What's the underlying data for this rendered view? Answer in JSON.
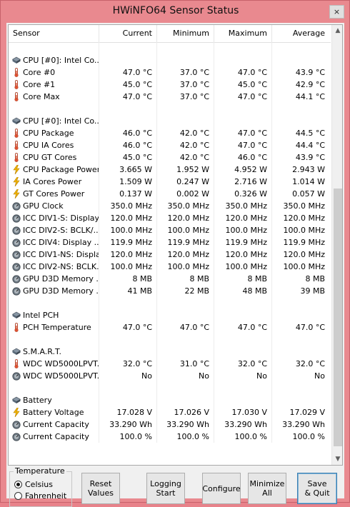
{
  "window": {
    "title": "HWiNFO64 Sensor Status",
    "close_glyph": "×"
  },
  "columns": [
    "Sensor",
    "Current",
    "Minimum",
    "Maximum",
    "Average"
  ],
  "rows": [
    {
      "kind": "blank"
    },
    {
      "kind": "group",
      "icon": "chip",
      "name": "CPU [#0]: Intel Co..."
    },
    {
      "kind": "data",
      "icon": "thermo",
      "name": "Core #0",
      "cur": "47.0 °C",
      "min": "37.0 °C",
      "max": "47.0 °C",
      "avg": "43.9 °C"
    },
    {
      "kind": "data",
      "icon": "thermo",
      "name": "Core #1",
      "cur": "45.0 °C",
      "min": "37.0 °C",
      "max": "45.0 °C",
      "avg": "42.9 °C"
    },
    {
      "kind": "data",
      "icon": "thermo",
      "name": "Core Max",
      "cur": "47.0 °C",
      "min": "37.0 °C",
      "max": "47.0 °C",
      "avg": "44.1 °C"
    },
    {
      "kind": "blank"
    },
    {
      "kind": "group",
      "icon": "chip",
      "name": "CPU [#0]: Intel Co..."
    },
    {
      "kind": "data",
      "icon": "thermo",
      "name": "CPU Package",
      "cur": "46.0 °C",
      "min": "42.0 °C",
      "max": "47.0 °C",
      "avg": "44.5 °C"
    },
    {
      "kind": "data",
      "icon": "thermo",
      "name": "CPU IA Cores",
      "cur": "46.0 °C",
      "min": "42.0 °C",
      "max": "47.0 °C",
      "avg": "44.4 °C"
    },
    {
      "kind": "data",
      "icon": "thermo",
      "name": "CPU GT Cores",
      "cur": "45.0 °C",
      "min": "42.0 °C",
      "max": "46.0 °C",
      "avg": "43.9 °C"
    },
    {
      "kind": "data",
      "icon": "bolt",
      "name": "CPU Package Power",
      "cur": "3.665 W",
      "min": "1.952 W",
      "max": "4.952 W",
      "avg": "2.943 W"
    },
    {
      "kind": "data",
      "icon": "bolt",
      "name": "IA Cores Power",
      "cur": "1.509 W",
      "min": "0.247 W",
      "max": "2.716 W",
      "avg": "1.014 W"
    },
    {
      "kind": "data",
      "icon": "bolt",
      "name": "GT Cores Power",
      "cur": "0.137 W",
      "min": "0.002 W",
      "max": "0.326 W",
      "avg": "0.057 W"
    },
    {
      "kind": "data",
      "icon": "gauge",
      "name": "GPU Clock",
      "cur": "350.0 MHz",
      "min": "350.0 MHz",
      "max": "350.0 MHz",
      "avg": "350.0 MHz"
    },
    {
      "kind": "data",
      "icon": "gauge",
      "name": "ICC DIV1-S: Display",
      "cur": "120.0 MHz",
      "min": "120.0 MHz",
      "max": "120.0 MHz",
      "avg": "120.0 MHz"
    },
    {
      "kind": "data",
      "icon": "gauge",
      "name": "ICC DIV2-S: BCLK/...",
      "cur": "100.0 MHz",
      "min": "100.0 MHz",
      "max": "100.0 MHz",
      "avg": "100.0 MHz"
    },
    {
      "kind": "data",
      "icon": "gauge",
      "name": "ICC DIV4: Display ...",
      "cur": "119.9 MHz",
      "min": "119.9 MHz",
      "max": "119.9 MHz",
      "avg": "119.9 MHz"
    },
    {
      "kind": "data",
      "icon": "gauge",
      "name": "ICC DIV1-NS: Display",
      "cur": "120.0 MHz",
      "min": "120.0 MHz",
      "max": "120.0 MHz",
      "avg": "120.0 MHz"
    },
    {
      "kind": "data",
      "icon": "gauge",
      "name": "ICC DIV2-NS: BCLK...",
      "cur": "100.0 MHz",
      "min": "100.0 MHz",
      "max": "100.0 MHz",
      "avg": "100.0 MHz"
    },
    {
      "kind": "data",
      "icon": "gauge",
      "name": "GPU D3D Memory ...",
      "cur": "8 MB",
      "min": "8 MB",
      "max": "8 MB",
      "avg": "8 MB"
    },
    {
      "kind": "data",
      "icon": "gauge",
      "name": "GPU D3D Memory ...",
      "cur": "41 MB",
      "min": "22 MB",
      "max": "48 MB",
      "avg": "39 MB"
    },
    {
      "kind": "blank"
    },
    {
      "kind": "group",
      "icon": "chip",
      "name": "Intel PCH"
    },
    {
      "kind": "data",
      "icon": "thermo",
      "name": "PCH Temperature",
      "cur": "47.0 °C",
      "min": "47.0 °C",
      "max": "47.0 °C",
      "avg": "47.0 °C"
    },
    {
      "kind": "blank"
    },
    {
      "kind": "group",
      "icon": "chip",
      "name": "S.M.A.R.T."
    },
    {
      "kind": "data",
      "icon": "thermo",
      "name": "WDC WD5000LPVT...",
      "cur": "32.0 °C",
      "min": "31.0 °C",
      "max": "32.0 °C",
      "avg": "32.0 °C"
    },
    {
      "kind": "data",
      "icon": "gauge",
      "name": "WDC WD5000LPVT...",
      "cur": "No",
      "min": "No",
      "max": "No",
      "avg": "No"
    },
    {
      "kind": "blank"
    },
    {
      "kind": "group",
      "icon": "chip",
      "name": "Battery"
    },
    {
      "kind": "data",
      "icon": "bolt",
      "name": "Battery Voltage",
      "cur": "17.028 V",
      "min": "17.026 V",
      "max": "17.030 V",
      "avg": "17.029 V"
    },
    {
      "kind": "data",
      "icon": "gauge",
      "name": "Current Capacity",
      "cur": "33.290 Wh",
      "min": "33.290 Wh",
      "max": "33.290 Wh",
      "avg": "33.290 Wh"
    },
    {
      "kind": "data",
      "icon": "gauge",
      "name": "Current Capacity",
      "cur": "100.0 %",
      "min": "100.0 %",
      "max": "100.0 %",
      "avg": "100.0 %"
    }
  ],
  "temperature": {
    "label": "Temperature",
    "options": [
      "Celsius",
      "Fahrenheit"
    ],
    "selected": "Celsius"
  },
  "buttons": {
    "reset": "Reset\nValues",
    "logging": "Logging\nStart",
    "configure": "Configure",
    "minimize": "Minimize\nAll",
    "save": "Save\n& Quit"
  },
  "scrollbar": {
    "up_glyph": "▲",
    "down_glyph": "▼"
  },
  "colors": {
    "title_bar": "#e9898f",
    "thermo": "#e05030",
    "bolt": "#f0b400",
    "chip": "#5a6a7a"
  }
}
